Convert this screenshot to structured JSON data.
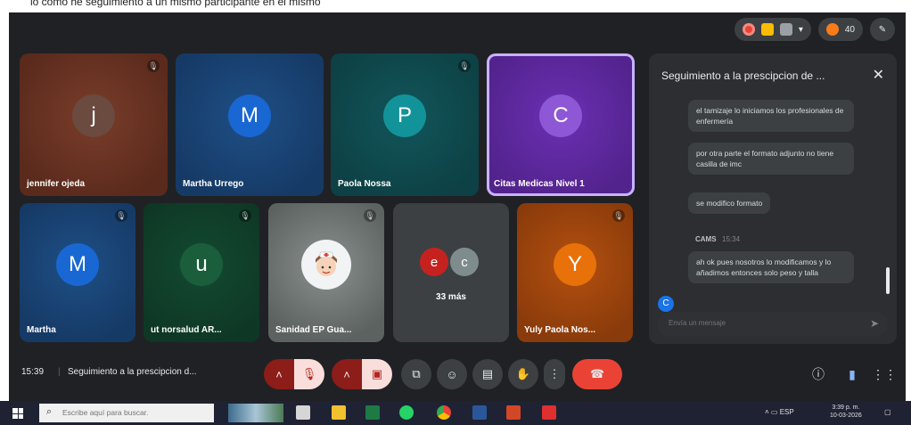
{
  "caption": "lo como he seguimiento a un mismo participante en el mismo",
  "topbar": {
    "extra_label": "40"
  },
  "tiles": [
    {
      "initial": "j",
      "name": "jennifer ojeda"
    },
    {
      "initial": "M",
      "name": "Martha Urrego"
    },
    {
      "initial": "P",
      "name": "Paola Nossa"
    },
    {
      "initial": "C",
      "name": "Citas Medicas Nivel 1"
    },
    {
      "initial": "M",
      "name": "Martha"
    },
    {
      "initial": "u",
      "name": "ut norsalud AR..."
    },
    {
      "initial": "",
      "name": "Sanidad EP Gua..."
    },
    {
      "initial": "e",
      "initial2": "c",
      "name": "33 más"
    },
    {
      "initial": "Y",
      "name": "Yuly Paola Nos..."
    }
  ],
  "chat": {
    "title": "Seguimiento a la prescipcion de ...",
    "messages": [
      "el tamizaje lo iniciamos los profesionales de enfermería",
      "por otra parte el formato adjunto no tiene casilla de imc",
      "se modifico formato"
    ],
    "sender_name": "CAMS",
    "sender_time": "15:34",
    "sender_initial": "C",
    "sender_message": "ah ok pues nosotros lo modificamos y lo añadimos entonces solo peso y talla",
    "input_placeholder": "Envía un mensaje"
  },
  "bottombar": {
    "time": "15:39",
    "meeting_title": "Seguimiento a la prescipcion d..."
  },
  "taskbar": {
    "search_placeholder": "Escribe aquí para buscar.",
    "tray_text": "ESP",
    "clock_time": "3:39 p. m.",
    "clock_date": "10-03-2026"
  },
  "colors": {
    "meet_bg": "#202124",
    "end_call": "#ea4335",
    "muted": "#f9dedc",
    "accent": "#8ab4f8",
    "chat_bg": "#2d2e31"
  }
}
